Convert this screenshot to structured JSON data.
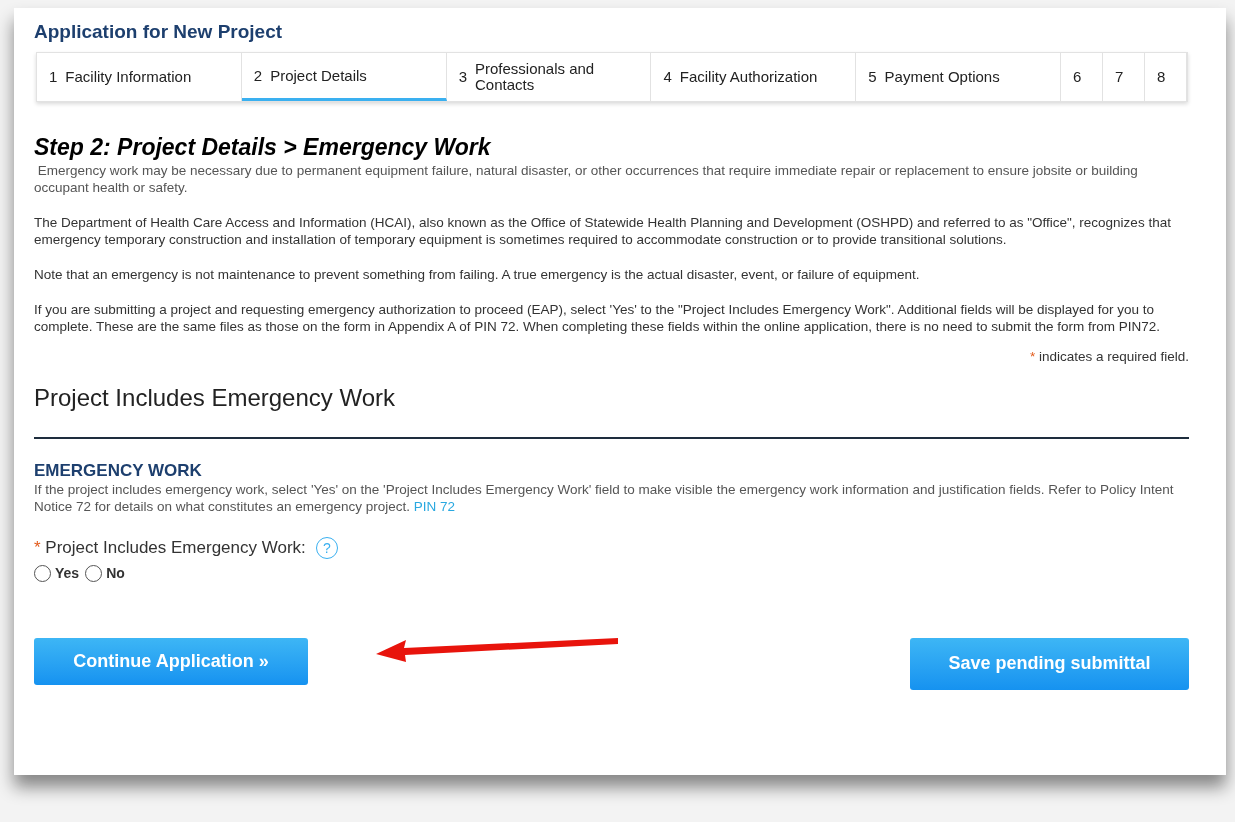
{
  "title": "Application for New Project",
  "steps": [
    {
      "number": "1",
      "label": "Facility Information",
      "selected": false
    },
    {
      "number": "2",
      "label": "Project Details",
      "selected": true
    },
    {
      "number": "3",
      "label": "Professionals and Contacts",
      "selected": false
    },
    {
      "number": "4",
      "label": "Facility Authorization",
      "selected": false
    },
    {
      "number": "5",
      "label": "Payment Options",
      "selected": false
    },
    {
      "number": "6",
      "selected": false
    },
    {
      "number": "7",
      "selected": false
    },
    {
      "number": "8",
      "selected": false
    }
  ],
  "step_heading": {
    "step": "Step 2",
    "separator": ":",
    "page": "Project Details",
    "arrow": ">",
    "section": "Emergency Work"
  },
  "paragraphs": [
    " Emergency work may be necessary due to permanent equipment failure, natural disaster, or other occurrences that require immediate repair or replacement to ensure jobsite or building occupant health or safety.",
    "The Department of Health Care Access and Information (HCAI), also known as the Office of Statewide Health Planning and Development (OSHPD) and referred to as \"Office\", recognizes that emergency temporary construction and installation of temporary equipment is sometimes required to accommodate construction or to provide transitional solutions.",
    "Note that an emergency is not maintenance to prevent something from failing. A true emergency is the actual disaster, event, or failure of equipment.",
    "If you are submitting a project and requesting  emergency authorization to proceed (EAP), select 'Yes' to the \"Project Includes Emergency Work\". Additional fields will be displayed for you to complete.  These are the same files as those on the form in Appendix A of PIN 72.  When completing these fields within the online application, there is no need to submit the form from PIN72."
  ],
  "required_note": {
    "mark": "*",
    "text": "indicates a required field."
  },
  "section_title": "Project Includes Emergency Work",
  "subsection": {
    "title": "EMERGENCY WORK",
    "description": "If the project includes emergency work, select 'Yes' on the 'Project Includes Emergency Work' field to make visible the emergency work information and justification fields. Refer to Policy Intent Notice 72 for details on what constitutes an emergency project.",
    "link": "PIN 72"
  },
  "field": {
    "required_mark": "*",
    "label": "Project Includes Emergency Work:",
    "help": "?",
    "options": [
      {
        "label": "Yes",
        "selected": false
      },
      {
        "label": "No",
        "selected": false
      }
    ]
  },
  "buttons": {
    "continue": "Continue Application »",
    "save": "Save pending submittal"
  }
}
